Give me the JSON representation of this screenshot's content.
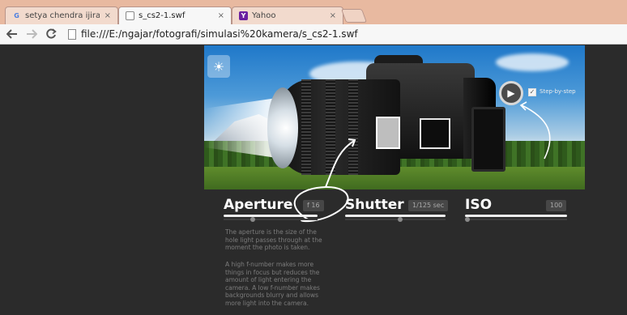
{
  "browser": {
    "tabs": [
      {
        "title": "setya chendra ijirae.com -",
        "favicon": "G",
        "active": false
      },
      {
        "title": "s_cs2-1.swf",
        "favicon": "",
        "active": true
      },
      {
        "title": "Yahoo",
        "favicon": "Y",
        "active": false
      }
    ],
    "close_glyph": "×",
    "url": "file:///E:/ngajar/fotografi/simulasi%20kamera/s_cs2-1.swf",
    "icons": {
      "back": "back-arrow-icon",
      "forward": "forward-arrow-icon",
      "reload": "reload-icon",
      "page": "page-icon"
    }
  },
  "simulator": {
    "sun_icon": "☀",
    "play_icon": "▶",
    "step_by_step_label": "Step-by-step",
    "step_by_step_checked": true,
    "controls": {
      "aperture": {
        "label": "Aperture",
        "value": "f 16",
        "slider_level": 0.3
      },
      "shutter": {
        "label": "Shutter",
        "value": "1/125 sec",
        "slider_level": 0.55
      },
      "iso": {
        "label": "ISO",
        "value": "100",
        "slider_level": 0.0
      }
    },
    "description": [
      "The aperture is the size of the hole light passes through at the moment the photo is taken.",
      "A high f-number makes more things in focus but reduces the amount of light entering the camera. A low f-number makes backgrounds blurry and allows more light into the camera."
    ]
  },
  "colors": {
    "tabstrip": "#e8b9a0",
    "stage_bg": "#2b2b2b",
    "favicon_google": "#4a7de0",
    "favicon_yahoo": "#6b1fa0"
  }
}
